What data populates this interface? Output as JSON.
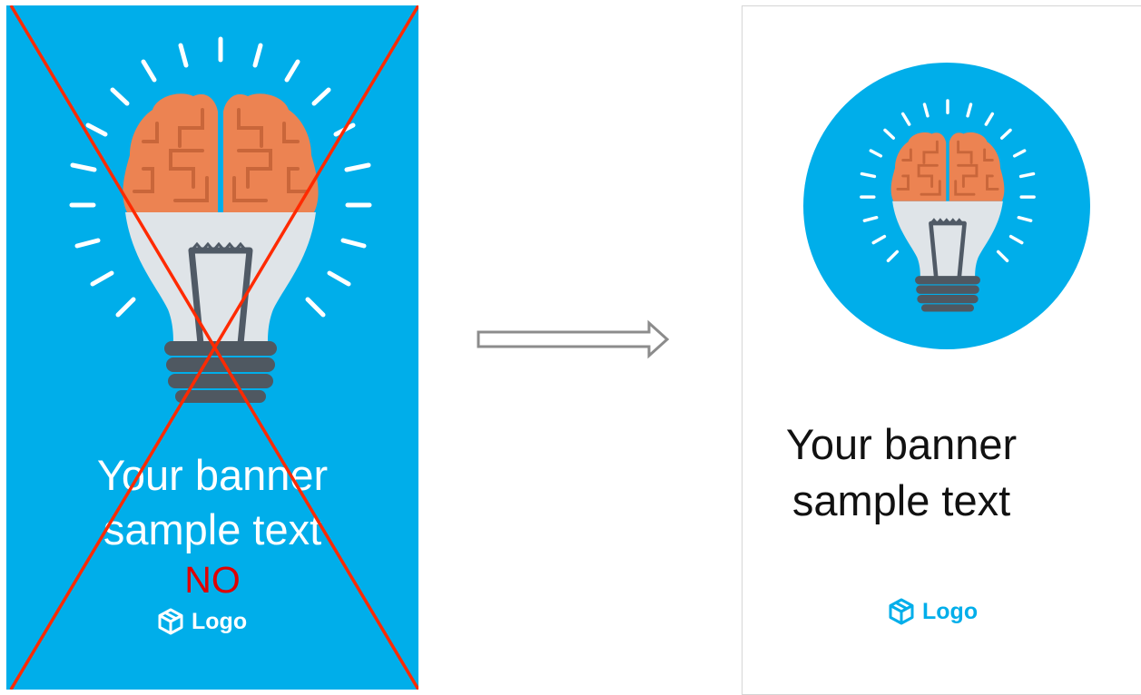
{
  "left_banner": {
    "title_line1": "Your banner",
    "title_line2": "sample text",
    "logo_text": "Logo",
    "verdict_text": "NO",
    "background_color": "#00aeea",
    "text_color": "#ffffff",
    "cross_color": "#ff2a00",
    "verdict_color": "#e00000"
  },
  "arrow": {
    "icon": "right-arrow-icon",
    "color": "#8c8c8c"
  },
  "right_banner": {
    "title_line1": "Your banner",
    "title_line2": "sample text",
    "logo_text": "Logo",
    "circle_color": "#00aeea",
    "text_color": "#111111",
    "logo_color": "#00aeea",
    "border_color": "#d5d5d5"
  },
  "illustration": {
    "icon": "brain-lightbulb-icon",
    "brain_color": "#ec8352",
    "brain_line_color": "#c9663a",
    "bulb_color": "#dfe4e8",
    "filament_color": "#505a66",
    "base_color": "#4f5861",
    "rays_color": "#ffffff"
  }
}
